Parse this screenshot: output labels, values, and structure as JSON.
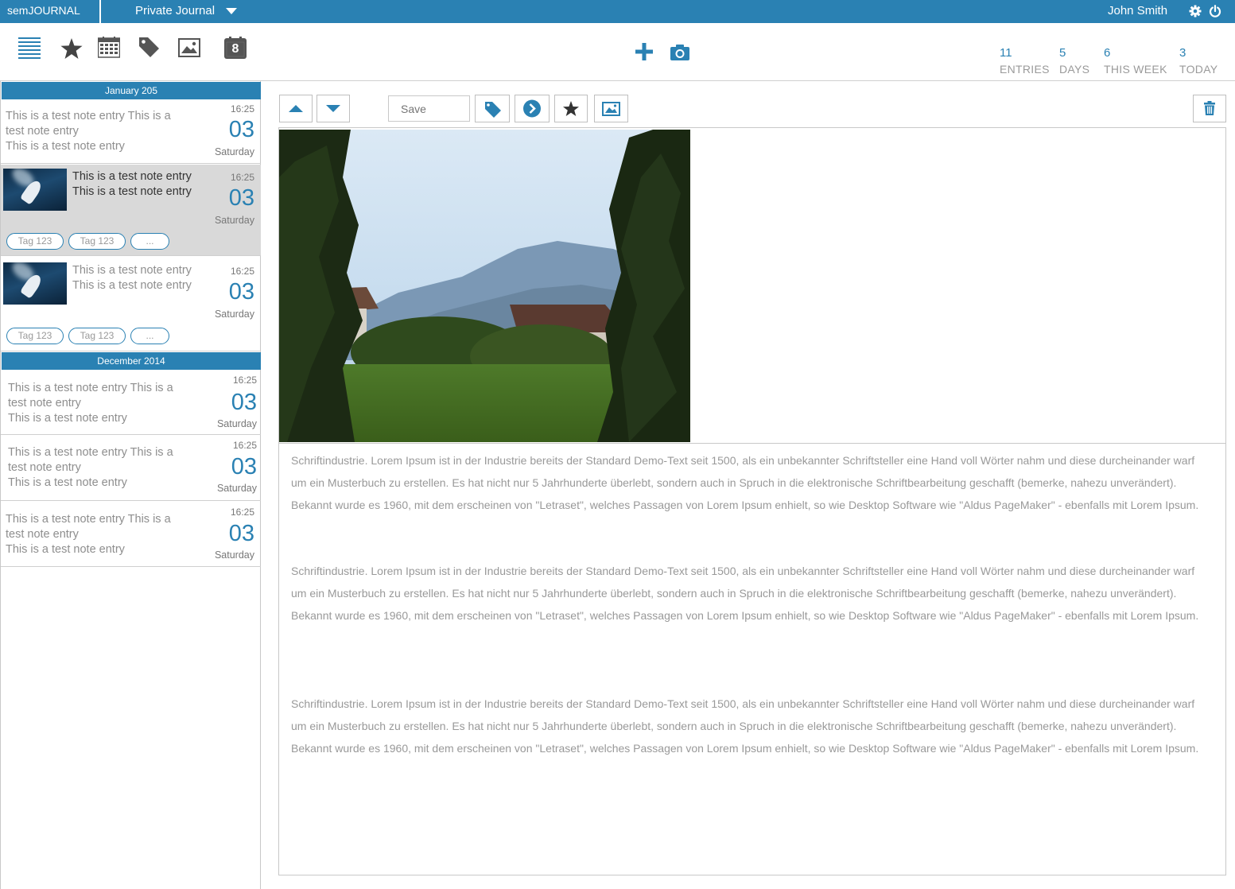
{
  "app": {
    "brand": "semJOURNAL",
    "journal": "Private Journal",
    "user": "John Smith"
  },
  "colors": {
    "accent": "#2a81b3",
    "selected_bg": "#d9d9d9"
  },
  "toolbar": {
    "left_icons": [
      "list-icon",
      "star-icon",
      "calendar-grid-icon",
      "tag-icon",
      "image-icon",
      "day-calendar-icon"
    ],
    "day_calendar_number": "8",
    "center_icons": [
      "add-icon",
      "camera-icon"
    ],
    "stats": [
      {
        "num": "11",
        "label": "ENTRIES"
      },
      {
        "num": "5",
        "label": "DAYS"
      },
      {
        "num": "6",
        "label": "THIS WEEK"
      },
      {
        "num": "3",
        "label": "TODAY"
      }
    ]
  },
  "sidebar": {
    "months": [
      "January 205",
      "December 2014"
    ],
    "entries": [
      {
        "lines": [
          "This is a test note entry This is a",
          "test note entry",
          "This is a test note entry"
        ],
        "time": "16:25",
        "day": "03",
        "weekday": "Saturday"
      },
      {
        "lines": [
          "This is a test note entry",
          "This is a test note entry"
        ],
        "time": "16:25",
        "day": "03",
        "weekday": "Saturday",
        "tags": [
          "Tag 123",
          "Tag 123",
          "..."
        ]
      },
      {
        "lines": [
          "This is a test note entry",
          "This is a test note entry"
        ],
        "time": "16:25",
        "day": "03",
        "weekday": "Saturday",
        "tags": [
          "Tag 123",
          "Tag 123",
          "..."
        ]
      },
      {
        "lines": [
          "This is a test note entry This is a",
          "test note entry",
          "This is a test note entry"
        ],
        "time": "16:25",
        "day": "03",
        "weekday": "Saturday"
      },
      {
        "lines": [
          "This is a test note entry This is a",
          "test note entry",
          "This is a test note entry"
        ],
        "time": "16:25",
        "day": "03",
        "weekday": "Saturday"
      },
      {
        "lines": [
          "This is a test note entry This is a",
          "test note entry",
          "This is a test note entry"
        ],
        "time": "16:25",
        "day": "03",
        "weekday": "Saturday"
      }
    ]
  },
  "editor": {
    "save_placeholder": "Save",
    "paragraphs": [
      "Schriftindustrie. Lorem Ipsum ist in der Industrie bereits der Standard Demo-Text seit 1500, als ein unbekannter Schriftsteller eine Hand voll Wörter nahm und diese durcheinander warf um ein Musterbuch zu erstellen. Es hat nicht nur 5 Jahrhunderte überlebt, sondern auch in Spruch in die elektronische Schriftbearbeitung geschafft (bemerke, nahezu unverändert). Bekannt wurde es 1960, mit dem erscheinen von \"Letraset\", welches Passagen von Lorem Ipsum enhielt, so wie Desktop Software wie \"Aldus PageMaker\" - ebenfalls mit Lorem Ipsum.",
      "Schriftindustrie. Lorem Ipsum ist in der Industrie bereits der Standard Demo-Text seit 1500, als ein unbekannter Schriftsteller eine Hand voll Wörter nahm und diese durcheinander warf um ein Musterbuch zu erstellen. Es hat nicht nur 5 Jahrhunderte überlebt, sondern auch in Spruch in die elektronische Schriftbearbeitung geschafft (bemerke, nahezu unverändert). Bekannt wurde es 1960, mit dem erscheinen von \"Letraset\", welches Passagen von Lorem Ipsum enhielt, so wie Desktop Software wie \"Aldus PageMaker\" - ebenfalls mit Lorem Ipsum.",
      "Schriftindustrie. Lorem Ipsum ist in der Industrie bereits der Standard Demo-Text seit 1500, als ein unbekannter Schriftsteller eine Hand voll Wörter nahm und diese durcheinander warf um ein Musterbuch zu erstellen. Es hat nicht nur 5 Jahrhunderte überlebt, sondern auch in Spruch in die elektronische Schriftbearbeitung geschafft (bemerke, nahezu unverändert). Bekannt wurde es 1960, mit dem erscheinen von \"Letraset\", welches Passagen von Lorem Ipsum enhielt, so wie Desktop Software wie \"Aldus PageMaker\" - ebenfalls mit Lorem Ipsum."
    ]
  }
}
